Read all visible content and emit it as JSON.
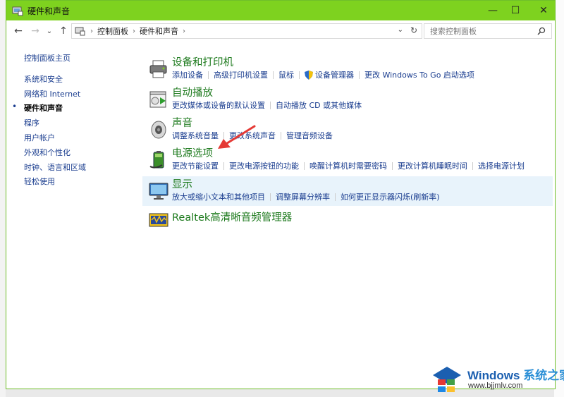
{
  "window": {
    "title": "硬件和声音",
    "controls": {
      "minimize": "—",
      "maximize": "☐",
      "close": "✕"
    }
  },
  "addressbar": {
    "breadcrumb": [
      "控制面板",
      "硬件和声音"
    ],
    "search_placeholder": "搜索控制面板"
  },
  "sidebar": {
    "items": [
      {
        "label": "控制面板主页"
      },
      {
        "label": "系统和安全"
      },
      {
        "label": "网络和 Internet"
      },
      {
        "label": "硬件和声音",
        "current": true
      },
      {
        "label": "程序"
      },
      {
        "label": "用户帐户"
      },
      {
        "label": "外观和个性化"
      },
      {
        "label": "时钟、语言和区域"
      },
      {
        "label": "轻松使用"
      }
    ]
  },
  "categories": [
    {
      "title": "设备和打印机",
      "icon": "printer-icon",
      "links": [
        "添加设备",
        "高级打印机设置",
        "鼠标",
        "设备管理器",
        "更改 Windows To Go 启动选项"
      ]
    },
    {
      "title": "自动播放",
      "icon": "autoplay-icon",
      "links": [
        "更改媒体或设备的默认设置",
        "自动播放 CD 或其他媒体"
      ]
    },
    {
      "title": "声音",
      "icon": "speaker-icon",
      "links": [
        "调整系统音量",
        "更改系统声音",
        "管理音频设备"
      ]
    },
    {
      "title": "电源选项",
      "icon": "battery-icon",
      "links": [
        "更改节能设置",
        "更改电源按钮的功能",
        "唤醒计算机时需要密码",
        "更改计算机睡眠时间",
        "选择电源计划"
      ]
    },
    {
      "title": "显示",
      "icon": "monitor-icon",
      "highlighted": true,
      "links": [
        "放大或缩小文本和其他项目",
        "调整屏幕分辨率",
        "如何更正显示器闪烁(刷新率)"
      ]
    },
    {
      "title": "Realtek高清晰音频管理器",
      "icon": "realtek-audio-icon",
      "links": []
    }
  ],
  "watermark": {
    "brand": "Windows",
    "brand_cn": "系统之家",
    "url": "www.bjjmlv.com"
  },
  "colors": {
    "titlebar": "#7ed21f",
    "category_title": "#1d7a1d",
    "link": "#1a3d8f",
    "highlight": "#e8f3fb",
    "annotation_arrow": "#e53935"
  }
}
